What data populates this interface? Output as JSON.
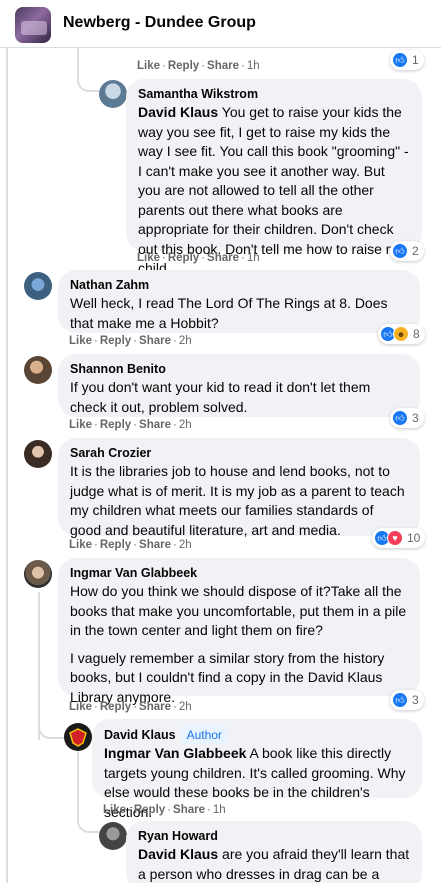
{
  "header": {
    "title": "Newberg - Dundee Group"
  },
  "actions": {
    "like": "Like",
    "reply": "Reply",
    "share": "Share",
    "sep": "·"
  },
  "top_fragment": {
    "time": "1h",
    "reaction_count": "1"
  },
  "comments": [
    {
      "author": "Samantha Wikstrom",
      "mention": "David Klaus",
      "text": "You get to raise your kids the way you see fit, I get to raise my kids the way I see fit. You call this book \"grooming\" - I can't make you see it another way. But you are not allowed to tell all the other parents out there what books are appropriate for their children. Don't check out this book. Don't tell me how to raise my child.",
      "time": "1h",
      "reaction_count": "2"
    },
    {
      "author": "Nathan Zahm",
      "text": "Well heck, I read The Lord Of The Rings at 8. Does that make me a Hobbit?",
      "time": "2h",
      "reaction_count": "8"
    },
    {
      "author": "Shannon Benito",
      "text": "If you don't want your kid to read it don't let them check it out, problem solved.",
      "time": "2h",
      "reaction_count": "3"
    },
    {
      "author": "Sarah Crozier",
      "text": "It is the libraries job to house and lend books, not to judge what is of merit. It is my job as a parent to teach my children what meets our families standards of good and beautiful literature, art and media.",
      "time": "2h",
      "reaction_count": "10"
    },
    {
      "author": "Ingmar Van Glabbeek",
      "text": "How do you think we should dispose of it?Take all the books that make you uncomfortable, put them in a pile in the town center and light them on fire?",
      "text2": "I vaguely remember a similar story from the history books, but I couldn't find a copy in the David Klaus Library anymore.",
      "time": "2h",
      "reaction_count": "3"
    },
    {
      "author": "David Klaus",
      "badge": "Author",
      "mention": "Ingmar Van Glabbeek",
      "text": "A book like this directly targets young children. It's called grooming. Why else would these books be in the children's section.",
      "time": "1h"
    },
    {
      "author": "Ryan Howard",
      "mention": "David Klaus",
      "text": "are you afraid they'll learn that a person who dresses in drag can be a normal"
    }
  ],
  "icons": {
    "like": "thumbs-up-icon",
    "haha": "laughing-face-icon",
    "love": "heart-icon"
  },
  "colors": {
    "bubble": "#f0f2f5",
    "meta_text": "#65676b",
    "like_blue": "#1877f2",
    "love_red": "#f33e58",
    "author_badge": "#1b74e4"
  }
}
